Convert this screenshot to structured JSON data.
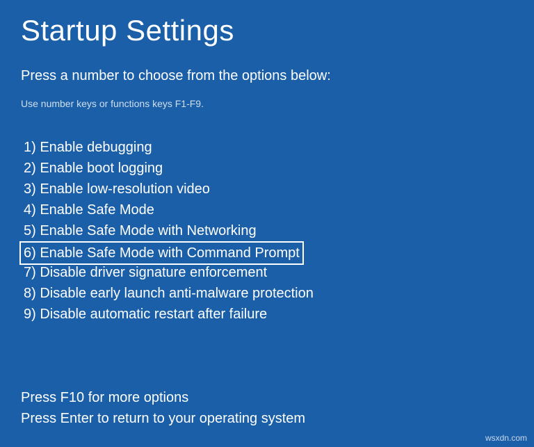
{
  "title": "Startup Settings",
  "subtitle": "Press a number to choose from the options below:",
  "hint": "Use number keys or functions keys F1-F9.",
  "options": [
    {
      "text": "1) Enable debugging",
      "highlighted": false
    },
    {
      "text": "2) Enable boot logging",
      "highlighted": false
    },
    {
      "text": "3) Enable low-resolution video",
      "highlighted": false
    },
    {
      "text": "4) Enable Safe Mode",
      "highlighted": false
    },
    {
      "text": "5) Enable Safe Mode with Networking",
      "highlighted": false
    },
    {
      "text": "6) Enable Safe Mode with Command Prompt",
      "highlighted": true
    },
    {
      "text": "7) Disable driver signature enforcement",
      "highlighted": false
    },
    {
      "text": "8) Disable early launch anti-malware protection",
      "highlighted": false
    },
    {
      "text": "9) Disable automatic restart after failure",
      "highlighted": false
    }
  ],
  "footer": {
    "more": "Press F10 for more options",
    "return": "Press Enter to return to your operating system"
  },
  "watermark": "wsxdn.com"
}
